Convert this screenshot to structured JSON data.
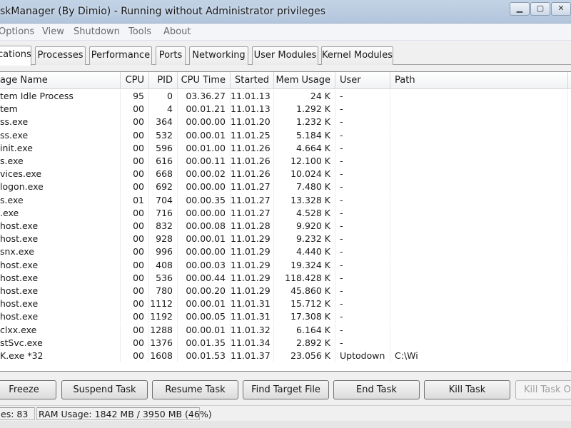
{
  "window": {
    "title": "skManager (By Dimio) - Running without Administrator privileges",
    "minimize_label": "▁",
    "restore_label": "▢",
    "close_label": "✕"
  },
  "menu": [
    "Options",
    "View",
    "Shutdown",
    "Tools",
    "About"
  ],
  "tabs": [
    "cations",
    "Processes",
    "Performance",
    "Ports",
    "Networking",
    "User Modules",
    "Kernel Modules"
  ],
  "active_tab": "cations",
  "table": {
    "columns": [
      "age Name",
      "CPU",
      "PID",
      "CPU Time",
      "Started",
      "Mem Usage",
      "User",
      "Path"
    ],
    "rows": [
      [
        "tem Idle Process",
        "95",
        "0",
        "03.36.27",
        "11.01.13",
        "24 K",
        "-",
        ""
      ],
      [
        "tem",
        "00",
        "4",
        "00.01.21",
        "11.01.13",
        "1.292 K",
        "-",
        ""
      ],
      [
        "ss.exe",
        "00",
        "364",
        "00.00.00",
        "11.01.20",
        "1.232 K",
        "-",
        ""
      ],
      [
        "ss.exe",
        "00",
        "532",
        "00.00.01",
        "11.01.25",
        "5.184 K",
        "-",
        ""
      ],
      [
        "init.exe",
        "00",
        "596",
        "00.01.00",
        "11.01.26",
        "4.664 K",
        "-",
        ""
      ],
      [
        "s.exe",
        "00",
        "616",
        "00.00.11",
        "11.01.26",
        "12.100 K",
        "-",
        ""
      ],
      [
        "vices.exe",
        "00",
        "668",
        "00.00.02",
        "11.01.26",
        "10.024 K",
        "-",
        ""
      ],
      [
        "logon.exe",
        "00",
        "692",
        "00.00.00",
        "11.01.27",
        "7.480 K",
        "-",
        ""
      ],
      [
        "s.exe",
        "01",
        "704",
        "00.00.35",
        "11.01.27",
        "13.328 K",
        "-",
        ""
      ],
      [
        ".exe",
        "00",
        "716",
        "00.00.00",
        "11.01.27",
        "4.528 K",
        "-",
        ""
      ],
      [
        "host.exe",
        "00",
        "832",
        "00.00.08",
        "11.01.28",
        "9.920 K",
        "-",
        ""
      ],
      [
        "host.exe",
        "00",
        "928",
        "00.00.01",
        "11.01.29",
        "9.232 K",
        "-",
        ""
      ],
      [
        "snx.exe",
        "00",
        "996",
        "00.00.00",
        "11.01.29",
        "4.440 K",
        "-",
        ""
      ],
      [
        "host.exe",
        "00",
        "408",
        "00.00.03",
        "11.01.29",
        "19.324 K",
        "-",
        ""
      ],
      [
        "host.exe",
        "00",
        "536",
        "00.00.44",
        "11.01.29",
        "118.428 K",
        "-",
        ""
      ],
      [
        "host.exe",
        "00",
        "780",
        "00.00.20",
        "11.01.29",
        "45.860 K",
        "-",
        ""
      ],
      [
        "host.exe",
        "00",
        "1112",
        "00.00.01",
        "11.01.31",
        "15.712 K",
        "-",
        ""
      ],
      [
        "host.exe",
        "00",
        "1192",
        "00.00.05",
        "11.01.31",
        "17.308 K",
        "-",
        ""
      ],
      [
        "clxx.exe",
        "00",
        "1288",
        "00.00.01",
        "11.01.32",
        "6.164 K",
        "-",
        ""
      ],
      [
        "stSvc.exe",
        "00",
        "1376",
        "00.01.35",
        "11.01.34",
        "2.892 K",
        "-",
        ""
      ],
      [
        "K.exe *32",
        "00",
        "1608",
        "00.01.53",
        "11.01.37",
        "23.056 K",
        "Uptodown",
        "C:\\Wi"
      ]
    ]
  },
  "buttons": {
    "freeze": "Freeze",
    "suspend": "Suspend Task",
    "resume": "Resume Task",
    "find_target": "Find Target File",
    "end_task": "End Task",
    "kill_task": "Kill Task",
    "kill_task_over": "Kill Task Ov"
  },
  "status": {
    "processes": "es: 83",
    "ram": "RAM Usage:  1842 MB / 3950 MB (46%)"
  }
}
